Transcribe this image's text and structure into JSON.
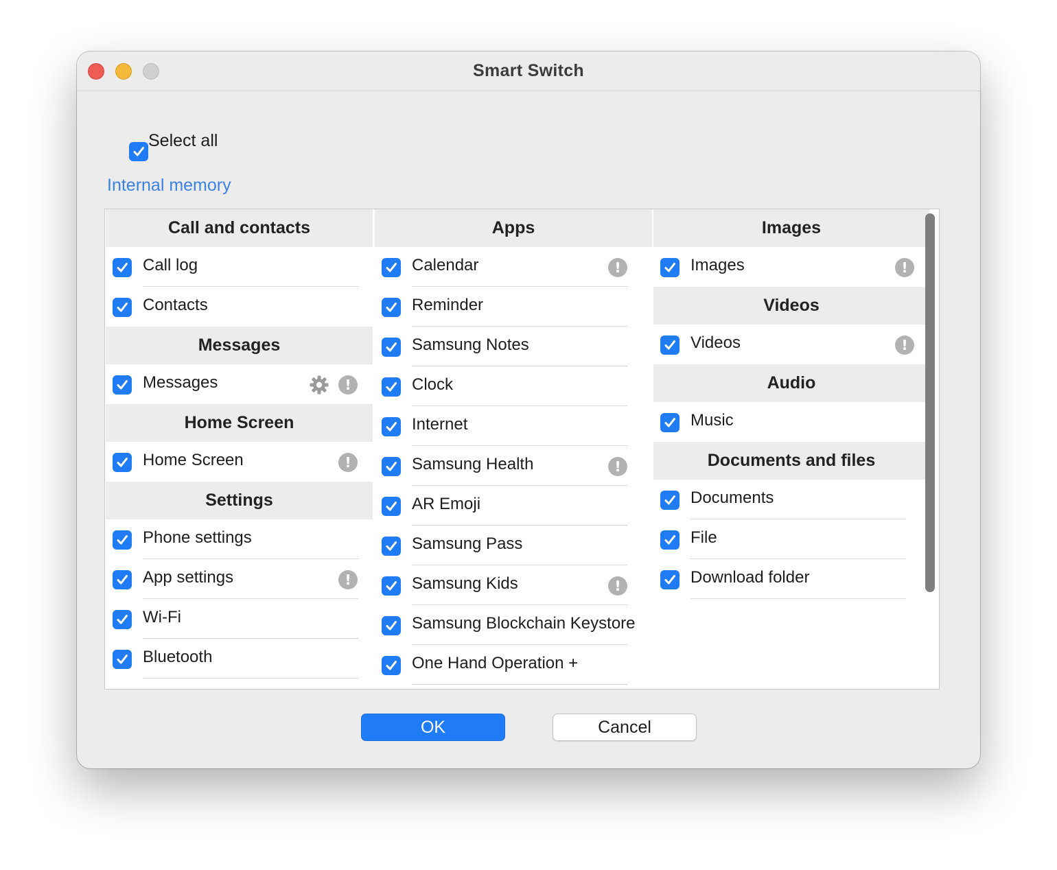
{
  "window": {
    "title": "Smart Switch"
  },
  "select_all": {
    "label": "Select all",
    "checked": true
  },
  "section_title": "Internal memory",
  "columns": [
    {
      "groups": [
        {
          "title": "Call and contacts",
          "items": [
            {
              "label": "Call log",
              "checked": true,
              "info": false,
              "gear": false
            },
            {
              "label": "Contacts",
              "checked": true,
              "info": false,
              "gear": false
            }
          ]
        },
        {
          "title": "Messages",
          "items": [
            {
              "label": "Messages",
              "checked": true,
              "info": true,
              "gear": true
            }
          ]
        },
        {
          "title": "Home Screen",
          "items": [
            {
              "label": "Home Screen",
              "checked": true,
              "info": true,
              "gear": false
            }
          ]
        },
        {
          "title": "Settings",
          "items": [
            {
              "label": "Phone settings",
              "checked": true,
              "info": false,
              "gear": false
            },
            {
              "label": "App settings",
              "checked": true,
              "info": true,
              "gear": false
            },
            {
              "label": "Wi-Fi",
              "checked": true,
              "info": false,
              "gear": false
            },
            {
              "label": "Bluetooth",
              "checked": true,
              "info": false,
              "gear": false
            }
          ]
        }
      ]
    },
    {
      "groups": [
        {
          "title": "Apps",
          "items": [
            {
              "label": "Calendar",
              "checked": true,
              "info": true,
              "gear": false
            },
            {
              "label": "Reminder",
              "checked": true,
              "info": false,
              "gear": false
            },
            {
              "label": "Samsung Notes",
              "checked": true,
              "info": false,
              "gear": false
            },
            {
              "label": "Clock",
              "checked": true,
              "info": false,
              "gear": false
            },
            {
              "label": "Internet",
              "checked": true,
              "info": false,
              "gear": false
            },
            {
              "label": "Samsung Health",
              "checked": true,
              "info": true,
              "gear": false
            },
            {
              "label": "AR Emoji",
              "checked": true,
              "info": false,
              "gear": false
            },
            {
              "label": "Samsung Pass",
              "checked": true,
              "info": false,
              "gear": false
            },
            {
              "label": "Samsung Kids",
              "checked": true,
              "info": true,
              "gear": false
            },
            {
              "label": "Samsung Blockchain Keystore",
              "checked": true,
              "info": false,
              "gear": false
            },
            {
              "label": "One Hand Operation +",
              "checked": true,
              "info": false,
              "gear": false
            }
          ]
        }
      ]
    },
    {
      "groups": [
        {
          "title": "Images",
          "items": [
            {
              "label": "Images",
              "checked": true,
              "info": true,
              "gear": false
            }
          ]
        },
        {
          "title": "Videos",
          "items": [
            {
              "label": "Videos",
              "checked": true,
              "info": true,
              "gear": false
            }
          ]
        },
        {
          "title": "Audio",
          "items": [
            {
              "label": "Music",
              "checked": true,
              "info": false,
              "gear": false
            }
          ]
        },
        {
          "title": "Documents and files",
          "items": [
            {
              "label": "Documents",
              "checked": true,
              "info": false,
              "gear": false
            },
            {
              "label": "File",
              "checked": true,
              "info": false,
              "gear": false
            },
            {
              "label": "Download folder",
              "checked": true,
              "info": false,
              "gear": false
            }
          ]
        }
      ]
    }
  ],
  "buttons": {
    "ok": "OK",
    "cancel": "Cancel"
  },
  "icons": {
    "info": "exclamation-info-icon",
    "gear": "gear-icon",
    "checkbox": "checkmark-icon"
  },
  "info_glyph": "!",
  "colors": {
    "accent": "#1f7cf4",
    "section_title": "#3b82e4",
    "info_icon": "#b2b2b2"
  }
}
